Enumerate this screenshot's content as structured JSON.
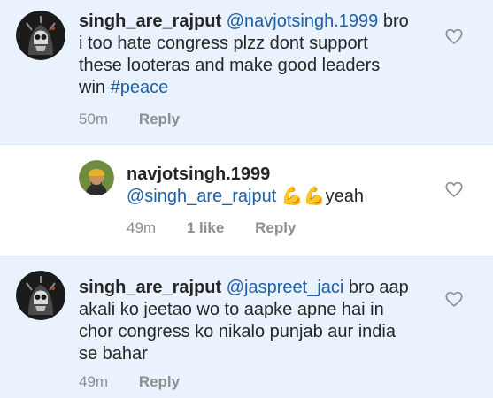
{
  "comments": [
    {
      "username": "singh_are_rajput",
      "mention": "@navjotsingh.1999",
      "text_lines": [
        "bro",
        "i too hate congress plzz dont support",
        "these looteras and make good leaders",
        "win "
      ],
      "hashtag": "#peace",
      "time": "50m",
      "reply": "Reply"
    },
    {
      "username": "navjotsingh.1999",
      "mention": "@singh_are_rajput",
      "emojis": "💪💪",
      "text": "yeah",
      "time": "49m",
      "likes": "1 like",
      "reply": "Reply"
    },
    {
      "username": "singh_are_rajput",
      "mention": "@jaspreet_jaci",
      "text_lines": [
        "bro aap",
        "akali ko jeetao wo to aapke apne hai in",
        "chor congress ko nikalo punjab aur india",
        "se bahar"
      ],
      "time": "49m",
      "reply": "Reply"
    }
  ],
  "colors": {
    "highlight_bg": "#e9f2fd",
    "mention": "#1f5fa8",
    "meta_text": "#8e8e8e"
  },
  "icons": [
    "skull-avatar",
    "turban-avatar",
    "heart-outline-icon"
  ]
}
